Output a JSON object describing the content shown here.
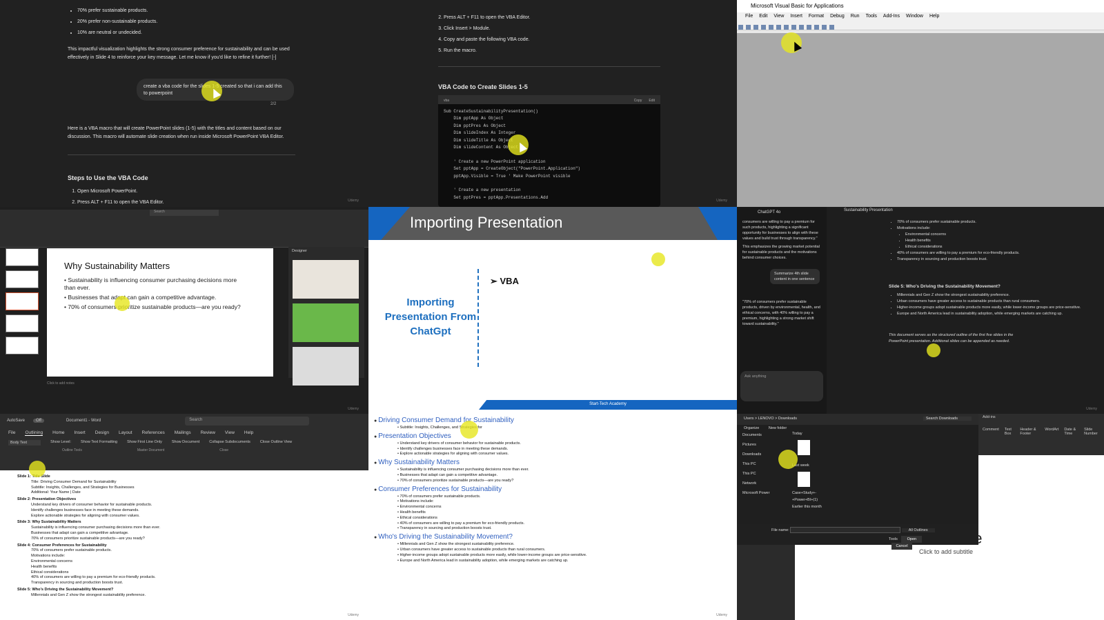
{
  "p1": {
    "bullets": [
      "70% prefer sustainable products.",
      "20% prefer non-sustainable products.",
      "10% are neutral or undecided."
    ],
    "para1": "This impactful visualization highlights the strong consumer preference for sustainability and can be used effectively in Slide 4 to reinforce your key message. Let me know if you'd like to refine it further! [-]",
    "prompt": "create a vba code for the slides 1-5 created so that i can add this to powerpoint",
    "pager": "2/2",
    "para2": "Here is a VBA macro that will create PowerPoint slides (1-5) with the titles and content based on our discussion. This macro will automate slide creation when run inside Microsoft PowerPoint VBA Editor.",
    "heading": "Steps to Use the VBA Code",
    "steps": [
      "Open Microsoft PowerPoint.",
      "Press ALT + F11 to open the VBA Editor."
    ],
    "watermark": "Udemy"
  },
  "p2": {
    "steps": [
      "Press ALT + F11 to open the VBA Editor.",
      "Click Insert > Module.",
      "Copy and paste the following VBA code.",
      "Run the macro."
    ],
    "heading": "VBA Code to Create Slides 1-5",
    "code_lang": "vba",
    "copy": "Copy",
    "edit": "Edit",
    "code": "Sub CreateSustainabilityPresentation()\n    Dim pptApp As Object\n    Dim pptPres As Object\n    Dim slideIndex As Integer\n    Dim slideTitle As Object\n    Dim slideContent As Object\n\n    ' Create a new PowerPoint application\n    Set pptApp = CreateObject(\"PowerPoint.Application\")\n    pptApp.Visible = True ' Make PowerPoint visible\n\n    ' Create a new presentation\n    Set pptPres = pptApp.Presentations.Add",
    "watermark": "Udemy"
  },
  "p3": {
    "title": "Microsoft Visual Basic for Applications",
    "menu": [
      "File",
      "Edit",
      "View",
      "Insert",
      "Format",
      "Debug",
      "Run",
      "Tools",
      "Add-Ins",
      "Window",
      "Help"
    ]
  },
  "p4": {
    "search": "Search",
    "slide_title": "Why Sustainability Matters",
    "slide_bullets": [
      "• Sustainability is influencing consumer purchasing decisions more than ever.",
      "• Businesses that adapt can gain a competitive advantage.",
      "• 70% of consumers prioritize sustainable products—are you ready?"
    ],
    "designer": "Designer",
    "notes": "Click to add notes",
    "watermark": "Udemy"
  },
  "p5": {
    "title": "Importing Presentation",
    "left_text": "Importing Presentation From ChatGpt",
    "bullet": "VBA",
    "footer": "Start-Tech Academy"
  },
  "p6": {
    "model": "ChatGPT 4o",
    "doc_title": "Sustainability Presentation",
    "side_text": "consumers are willing to pay a premium for such products, highlighting a significant opportunity for businesses to align with these values and build trust through transparency.\"",
    "side_text2": "This emphasizes the growing market potential for sustainable products and the motivations behind consumer choices.",
    "side_prompt": "Summarize 4th slide content in one sentence",
    "side_quote": "\"70% of consumers prefer sustainable products, driven by environmental, health, and ethical concerns, with 40% willing to pay a premium, highlighting a strong market shift toward sustainability.\"",
    "ask": "Ask anything",
    "main_bullets": [
      "70% of consumers prefer sustainable products.",
      "Motivations include:",
      "Environmental concerns",
      "Health benefits",
      "Ethical considerations",
      "40% of consumers are willing to pay a premium for eco-friendly products.",
      "Transparency in sourcing and production boosts trust."
    ],
    "slide5": "Slide 5: Who's Driving the Sustainability Movement?",
    "slide5_bullets": [
      "Millennials and Gen Z show the strongest sustainability preference.",
      "Urban consumers have greater access to sustainable products than rural consumers.",
      "Higher-income groups adopt sustainable products more easily, while lower-income groups are price-sensitive.",
      "Europe and North America lead in sustainability adoption, while emerging markets are catching up."
    ],
    "footer_note": "This document serves as the structured outline of the first five slides in the PowerPoint presentation. Additional slides can be appended as needed.",
    "watermark": "Udemy"
  },
  "p7": {
    "autosave": "AutoSave",
    "toggle": "Off",
    "doc": "Document1 - Word",
    "search": "Search",
    "tabs": [
      "File",
      "Outlining",
      "Home",
      "Insert",
      "Design",
      "Layout",
      "References",
      "Mailings",
      "Review",
      "View",
      "Help"
    ],
    "level": "Body Text",
    "opts": [
      "Show Level:",
      "Show Text Formatting",
      "Show First Line Only"
    ],
    "btns": [
      "Show Document",
      "Collapse Subdocuments",
      "Close Outline View"
    ],
    "groups": [
      "Outline Tools",
      "Master Document",
      "Close"
    ],
    "outline": [
      {
        "h": "Slide 1: Title Slide",
        "sub": [
          "Title: Driving Consumer Demand for Sustainability",
          "Subtitle: Insights, Challenges, and Strategies for Businesses",
          "Additional: Your Name | Date"
        ]
      },
      {
        "h": "Slide 2: Presentation Objectives",
        "sub": [
          "Understand key drivers of consumer behavior for sustainable products.",
          "Identify challenges businesses face in meeting these demands.",
          "Explore actionable strategies for aligning with consumer values."
        ]
      },
      {
        "h": "Slide 3: Why Sustainability Matters",
        "sub": [
          "Sustainability is influencing consumer purchasing decisions more than ever.",
          "Businesses that adapt can gain a competitive advantage.",
          "70% of consumers prioritize sustainable products—are you ready?"
        ]
      },
      {
        "h": "Slide 4: Consumer Preferences for Sustainability",
        "sub": [
          "70% of consumers prefer sustainable products.",
          "Motivations include:",
          "Environmental concerns",
          "Health benefits",
          "Ethical considerations",
          "40% of consumers are willing to pay a premium for eco-friendly products.",
          "Transparency in sourcing and production boosts trust."
        ]
      },
      {
        "h": "Slide 5: Who's Driving the Sustainability Movement?",
        "sub": [
          "Millennials and Gen Z show the strongest sustainability preference."
        ]
      }
    ],
    "watermark": "Udemy"
  },
  "p8": {
    "outline": [
      {
        "h": "Driving Consumer Demand for Sustainability",
        "sub": [
          "Subtitle: Insights, Challenges, and Strategies for"
        ]
      },
      {
        "h": "Presentation Objectives",
        "sub": [
          "Understand key drivers of consumer behavior for sustainable products.",
          "Identify challenges businesses face in meeting these demands.",
          "Explore actionable strategies for aligning with consumer values."
        ]
      },
      {
        "h": "Why Sustainability Matters",
        "sub": [
          "Sustainability is influencing consumer purchasing decisions more than ever.",
          "Businesses that adapt can gain a competitive advantage.",
          "70% of consumers prioritize sustainable products—are you ready?"
        ]
      },
      {
        "h": "Consumer Preferences for Sustainability",
        "sub": [
          "70% of consumers prefer sustainable products.",
          "Motivations include:",
          "Environmental concerns",
          "Health benefits",
          "Ethical considerations",
          "40% of consumers are willing to pay a premium for eco-friendly products.",
          "Transparency in sourcing and production boosts trust."
        ]
      },
      {
        "h": "Who's Driving the Sustainability Movement?",
        "sub": [
          "Millennials and Gen Z show the strongest sustainability preference.",
          "Urban consumers have greater access to sustainable products than rural consumers.",
          "Higher-income groups adopt sustainable products more easily, while lower-income groups are price-sensitive.",
          "Europe and North America lead in sustainability adoption, while emerging markets are catching up."
        ]
      }
    ],
    "watermark": "Udemy"
  },
  "p9": {
    "path": "Users > LENOVO > Downloads",
    "search": "Search Downloads",
    "organize": "Organize",
    "newfolder": "New folder",
    "nav": [
      "Documents",
      "Pictures",
      "Downloads",
      "This PC",
      "This PC",
      "Network",
      "Microsoft Power"
    ],
    "today": "Today",
    "lastweek": "Last week",
    "file2": "Case+Study+-+Power+BI+(1)",
    "earlier": "Earlier this month",
    "filename": "File name:",
    "filter": "All Outlines",
    "tools": "Tools",
    "open": "Open",
    "cancel": "Cancel",
    "ribbon": [
      "Add-ins",
      "Comment",
      "Text Box",
      "Header & Footer",
      "WordArt",
      "Date & Time",
      "Slide Number"
    ],
    "title": "I title",
    "subtitle": "Click to add subtitle"
  }
}
